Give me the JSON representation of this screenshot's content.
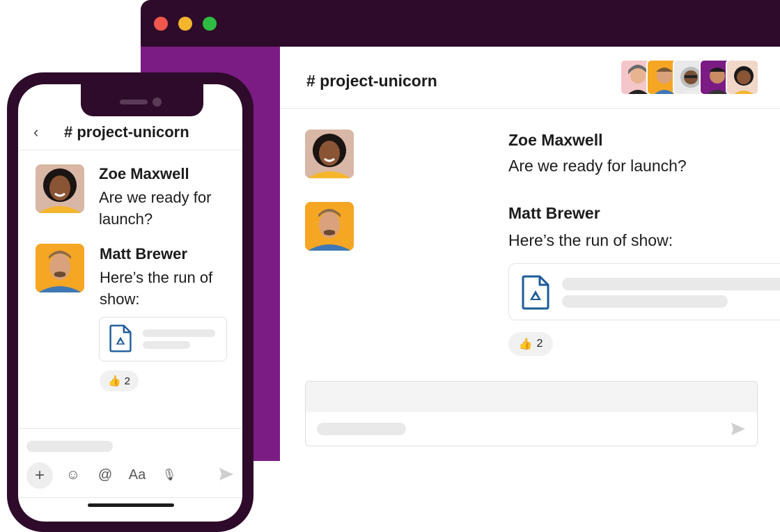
{
  "desktop": {
    "channel_title": "# project-unicorn",
    "messages": [
      {
        "author": "Zoe Maxwell",
        "text": "Are we ready for launch?"
      },
      {
        "author": "Matt Brewer",
        "text": "Here’s the run of show:"
      }
    ],
    "reaction": {
      "emoji": "👍",
      "count": "2"
    },
    "member_avatars": [
      "avatar-woman-gray-hair",
      "avatar-man-orange",
      "avatar-woman-glasses",
      "avatar-man-smiling",
      "avatar-woman-zoe"
    ]
  },
  "phone": {
    "back_label": "‹",
    "channel_title": "# project-unicorn",
    "messages": [
      {
        "author": "Zoe Maxwell",
        "text": "Are we ready for launch?"
      },
      {
        "author": "Matt Brewer",
        "text": "Here’s the run of show:"
      }
    ],
    "reaction": {
      "emoji": "👍",
      "count": "2"
    },
    "toolbar": {
      "plus": "+",
      "emoji": "☺",
      "mention": "@",
      "format": "Aa",
      "mic": "🎙"
    }
  },
  "colors": {
    "titlebar": "#2e0b2b",
    "sidebar": "#7b1c84",
    "window_dot_red": "#f0564c",
    "window_dot_yellow": "#f5b52c",
    "window_dot_green": "#2dbc41",
    "file_icon": "#1d5b9a"
  }
}
